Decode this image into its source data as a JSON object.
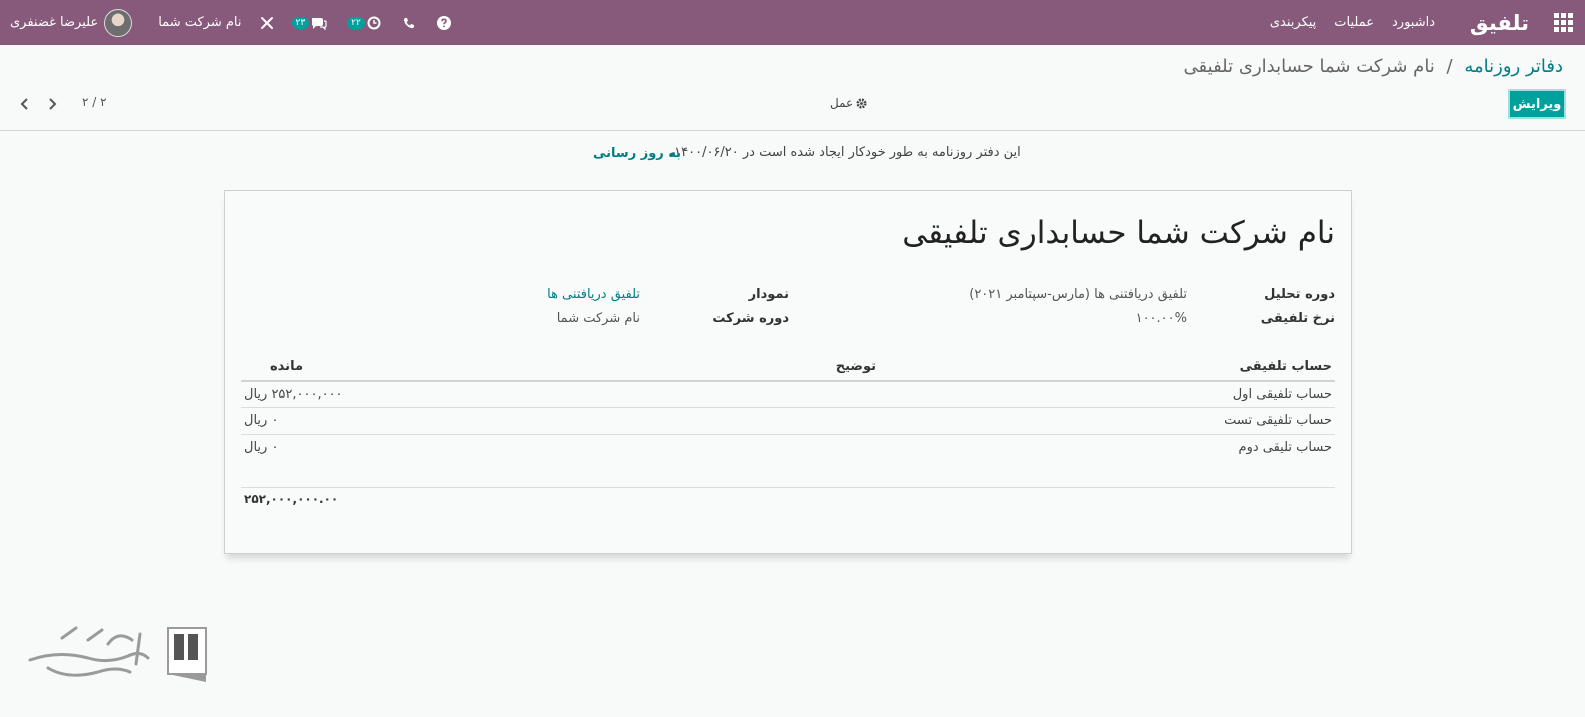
{
  "navbar": {
    "brand": "تلفیق",
    "menu": [
      "داشبورد",
      "عملیات",
      "پیکربندی"
    ],
    "user_name": "علیرضا غضنفری",
    "company": "نام شرکت شما",
    "messages_count": "۲۳",
    "activities_count": "۲۲"
  },
  "control_panel": {
    "breadcrumb_parent": "دفاتر روزنامه",
    "breadcrumb_separator": "/",
    "breadcrumb_current": "نام شرکت شما حسابداری تلفیقی",
    "edit_label": "ویرایش",
    "action_label": "عمل",
    "pager": "۲ / ۲"
  },
  "alert": {
    "message": "این دفتر روزنامه به طور خودکار ایجاد شده است در ۱۴۰۰/۰۶/۲۰.",
    "link": "به روز رسانی"
  },
  "form": {
    "title": "نام شرکت شما حسابداری تلفیقی",
    "fields": {
      "period_label": "دوره تحلیل",
      "period_value": "تلفیق دریافتنی ها (مارس-سپتامبر ۲۰۲۱)",
      "rate_label": "نرخ تلفیقی",
      "rate_value": "۱۰۰.۰۰%",
      "chart_label": "نمودار",
      "chart_value": "تلفیق دریافتنی ها",
      "company_period_label": "دوره شرکت",
      "company_period_value": "نام شرکت شما"
    },
    "table": {
      "headers": [
        "حساب تلفیقی",
        "توضیح",
        "مانده"
      ],
      "rows": [
        [
          "حساب تلفیقی اول",
          "",
          "۲۵۲,۰۰۰,۰۰۰ ریال"
        ],
        [
          "حساب تلفیقی تست",
          "",
          "۰ ریال"
        ],
        [
          "حساب تلیقی دوم",
          "",
          "۰ ریال"
        ]
      ],
      "total": "۲۵۲,۰۰۰,۰۰۰.۰۰"
    }
  },
  "colors": {
    "navbar": "#875a7b",
    "primary": "#00a09d",
    "link": "#017e84"
  },
  "icons": [
    "apps-grid-icon",
    "question-icon",
    "phone-icon",
    "clock-icon",
    "chat-icon",
    "tools-icon",
    "gear-icon",
    "chevron-left-icon",
    "chevron-right-icon"
  ]
}
